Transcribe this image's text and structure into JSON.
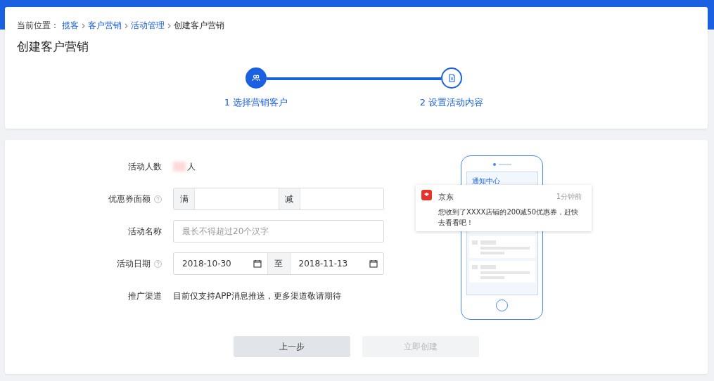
{
  "breadcrumb": {
    "label": "当前位置：",
    "items": [
      {
        "text": "揽客",
        "kind": "link"
      },
      {
        "text": "客户营销",
        "kind": "link"
      },
      {
        "text": "活动管理",
        "kind": "link"
      },
      {
        "text": "创建客户营销",
        "kind": "current"
      }
    ]
  },
  "page_title": "创建客户营销",
  "steps": [
    {
      "label": "1 选择营销客户",
      "selected": true,
      "kind": "users"
    },
    {
      "label": "2 设置活动内容",
      "selected": false,
      "kind": "document"
    }
  ],
  "form": {
    "rows": [
      {
        "kind": "count",
        "label": "活动人数",
        "help": false,
        "unit": "人"
      },
      {
        "kind": "range",
        "label": "优惠券面额",
        "help": true,
        "prefix": "满",
        "middle": "减"
      },
      {
        "kind": "text",
        "label": "活动名称",
        "help": false,
        "placeholder": "最长不得超过20个汉字"
      },
      {
        "kind": "dates",
        "label": "活动日期",
        "help": true,
        "start": "2018-10-30",
        "middle": "至",
        "end": "2018-11-13"
      },
      {
        "kind": "note",
        "label": "推广渠道",
        "help": false,
        "text": "目前仅支持APP消息推送，更多渠道敬请期待"
      }
    ]
  },
  "preview": {
    "header": "通知中心",
    "notification": {
      "app": "京东",
      "time": "1分钟前",
      "message": "您收到了XXXX店铺的200减50优惠券，赶快去看看吧！"
    }
  },
  "buttons": [
    {
      "label": "上一步",
      "disabled": false
    },
    {
      "label": "立即创建",
      "disabled": true
    }
  ]
}
